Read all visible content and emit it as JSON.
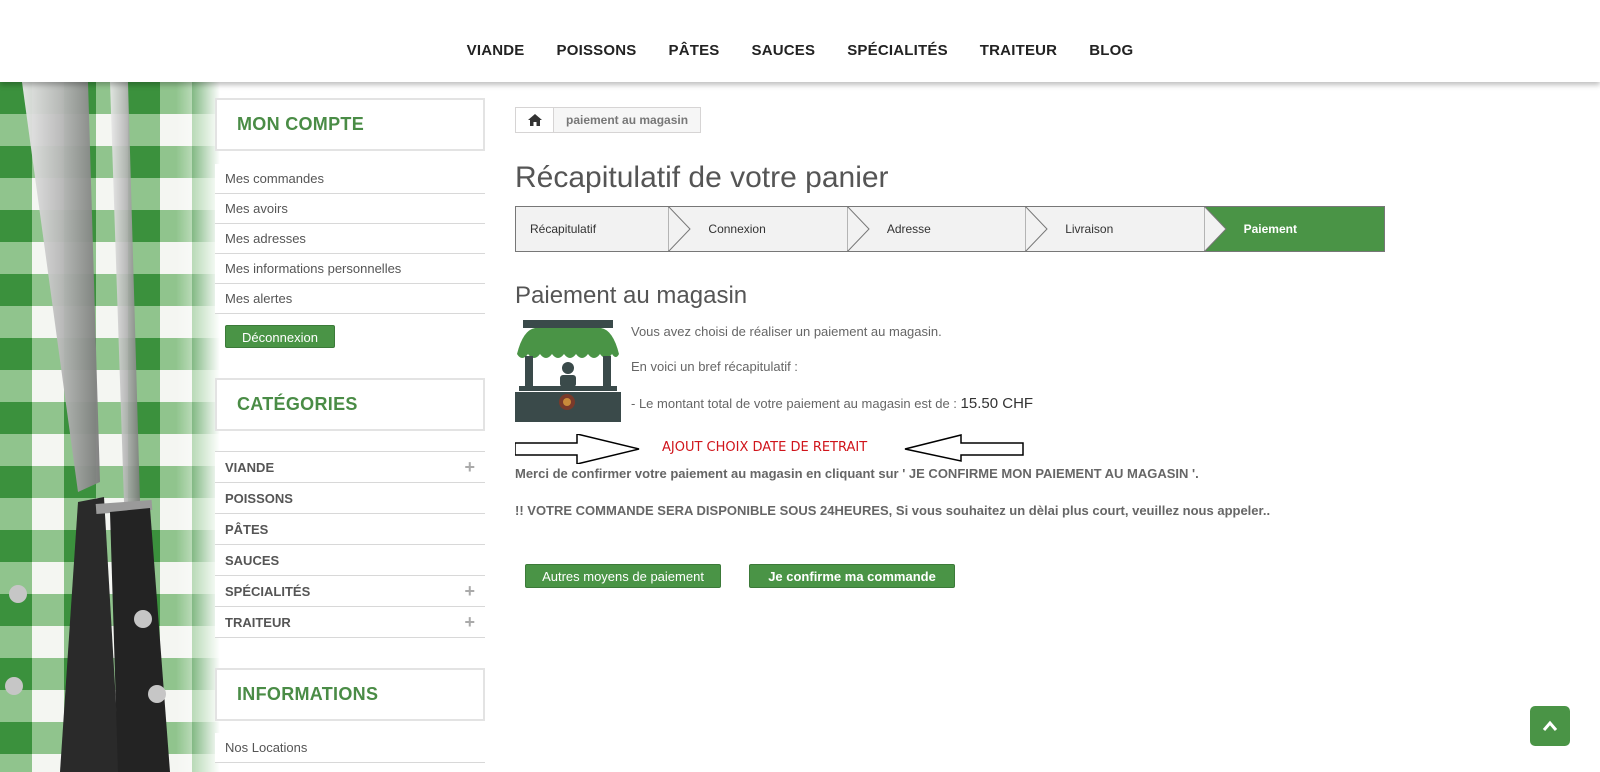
{
  "nav": [
    "VIANDE",
    "POISSONS",
    "PÂTES",
    "SAUCES",
    "SPÉCIALITÉS",
    "TRAITEUR",
    "BLOG"
  ],
  "sidebar": {
    "account_title": "MON COMPTE",
    "account_items": [
      "Mes commandes",
      "Mes avoirs",
      "Mes adresses",
      "Mes informations personnelles",
      "Mes alertes"
    ],
    "logout_label": "Déconnexion",
    "categories_title": "CATÉGORIES",
    "categories": [
      "VIANDE",
      "POISSONS",
      "PÂTES",
      "SAUCES",
      "SPÉCIALITÉS",
      "TRAITEUR"
    ],
    "info_title": "INFORMATIONS",
    "info_items": [
      "Nos Locations"
    ]
  },
  "breadcrumb": {
    "current": "paiement au magasin"
  },
  "page_title": "Récapitulatif de votre panier",
  "steps": [
    "Récapitulatif",
    "Connexion",
    "Adresse",
    "Livraison",
    "Paiement"
  ],
  "payment": {
    "heading": "Paiement au magasin",
    "line1": "Vous avez choisi de réaliser un paiement au magasin.",
    "line2": "En voici un bref récapitulatif :",
    "line3": "- Le montant total de votre paiement au magasin est de :",
    "amount": "15.50 CHF",
    "annotation": "AJOUT CHOIX DATE DE RETRAIT",
    "confirm_text": "Merci de confirmer votre paiement au magasin en cliquant sur ' JE CONFIRME MON PAIEMENT AU MAGASIN '.",
    "notice_text": "!! VOTRE COMMANDE SERA DISPONIBLE SOUS 24HEURES, Si vous souhaitez un dèlai plus court, veuillez nous appeler.."
  },
  "buttons": {
    "other_methods": "Autres moyens de paiement",
    "confirm": "Je confirme ma commande"
  },
  "colors": {
    "accent": "#4a9446",
    "annotation": "#d0141b"
  },
  "icons": {
    "home": "home-icon",
    "scroll_top": "chevron-up-icon",
    "shop": "shop-icon"
  }
}
